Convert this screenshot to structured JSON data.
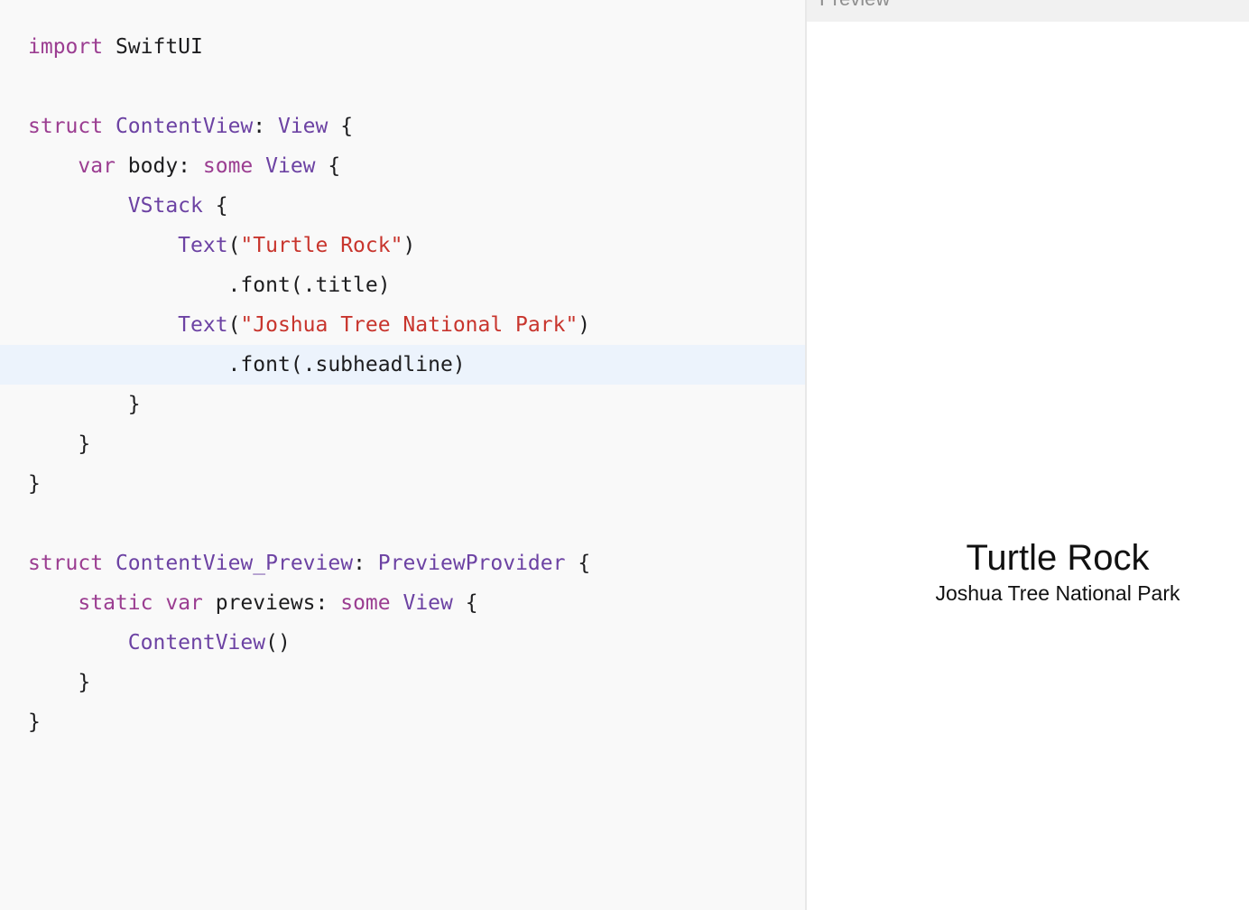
{
  "editor": {
    "lines": [
      {
        "tokens": [
          {
            "t": "import",
            "k": "kw"
          },
          {
            "t": " SwiftUI",
            "k": "pl"
          }
        ]
      },
      {
        "tokens": []
      },
      {
        "tokens": [
          {
            "t": "struct",
            "k": "kw"
          },
          {
            "t": " ",
            "k": "pl"
          },
          {
            "t": "ContentView",
            "k": "ty"
          },
          {
            "t": ": ",
            "k": "pl"
          },
          {
            "t": "View",
            "k": "ty"
          },
          {
            "t": " {",
            "k": "pl"
          }
        ]
      },
      {
        "tokens": [
          {
            "t": "    ",
            "k": "pl"
          },
          {
            "t": "var",
            "k": "kw"
          },
          {
            "t": " body: ",
            "k": "pl"
          },
          {
            "t": "some",
            "k": "kw"
          },
          {
            "t": " ",
            "k": "pl"
          },
          {
            "t": "View",
            "k": "ty"
          },
          {
            "t": " {",
            "k": "pl"
          }
        ]
      },
      {
        "tokens": [
          {
            "t": "        ",
            "k": "pl"
          },
          {
            "t": "VStack",
            "k": "ty"
          },
          {
            "t": " {",
            "k": "pl"
          }
        ]
      },
      {
        "tokens": [
          {
            "t": "            ",
            "k": "pl"
          },
          {
            "t": "Text",
            "k": "ty"
          },
          {
            "t": "(",
            "k": "pl"
          },
          {
            "t": "\"Turtle Rock\"",
            "k": "str"
          },
          {
            "t": ")",
            "k": "pl"
          }
        ]
      },
      {
        "tokens": [
          {
            "t": "                .font(.title)",
            "k": "pl"
          }
        ]
      },
      {
        "tokens": [
          {
            "t": "            ",
            "k": "pl"
          },
          {
            "t": "Text",
            "k": "ty"
          },
          {
            "t": "(",
            "k": "pl"
          },
          {
            "t": "\"Joshua Tree National Park\"",
            "k": "str"
          },
          {
            "t": ")",
            "k": "pl"
          }
        ]
      },
      {
        "highlighted": true,
        "tokens": [
          {
            "t": "                .font(.subheadline)",
            "k": "pl"
          }
        ]
      },
      {
        "tokens": [
          {
            "t": "        }",
            "k": "pl"
          }
        ]
      },
      {
        "tokens": [
          {
            "t": "    }",
            "k": "pl"
          }
        ]
      },
      {
        "tokens": [
          {
            "t": "}",
            "k": "pl"
          }
        ]
      },
      {
        "tokens": []
      },
      {
        "tokens": [
          {
            "t": "struct",
            "k": "kw"
          },
          {
            "t": " ",
            "k": "pl"
          },
          {
            "t": "ContentView_Preview",
            "k": "ty"
          },
          {
            "t": ": ",
            "k": "pl"
          },
          {
            "t": "PreviewProvider",
            "k": "ty"
          },
          {
            "t": " {",
            "k": "pl"
          }
        ]
      },
      {
        "tokens": [
          {
            "t": "    ",
            "k": "pl"
          },
          {
            "t": "static",
            "k": "kw"
          },
          {
            "t": " ",
            "k": "pl"
          },
          {
            "t": "var",
            "k": "kw"
          },
          {
            "t": " previews: ",
            "k": "pl"
          },
          {
            "t": "some",
            "k": "kw"
          },
          {
            "t": " ",
            "k": "pl"
          },
          {
            "t": "View",
            "k": "ty"
          },
          {
            "t": " {",
            "k": "pl"
          }
        ]
      },
      {
        "tokens": [
          {
            "t": "        ",
            "k": "pl"
          },
          {
            "t": "ContentView",
            "k": "ty"
          },
          {
            "t": "()",
            "k": "pl"
          }
        ]
      },
      {
        "tokens": [
          {
            "t": "    }",
            "k": "pl"
          }
        ]
      },
      {
        "tokens": [
          {
            "t": "}",
            "k": "pl"
          }
        ]
      }
    ]
  },
  "preview": {
    "header_label": "Preview",
    "title": "Turtle Rock",
    "subtitle": "Joshua Tree National Park"
  },
  "colors": {
    "keyword": "#9b3d91",
    "type": "#6c42a3",
    "string": "#c8352d",
    "plain": "#1d1d1f",
    "line_highlight": "#ecf3fc"
  }
}
